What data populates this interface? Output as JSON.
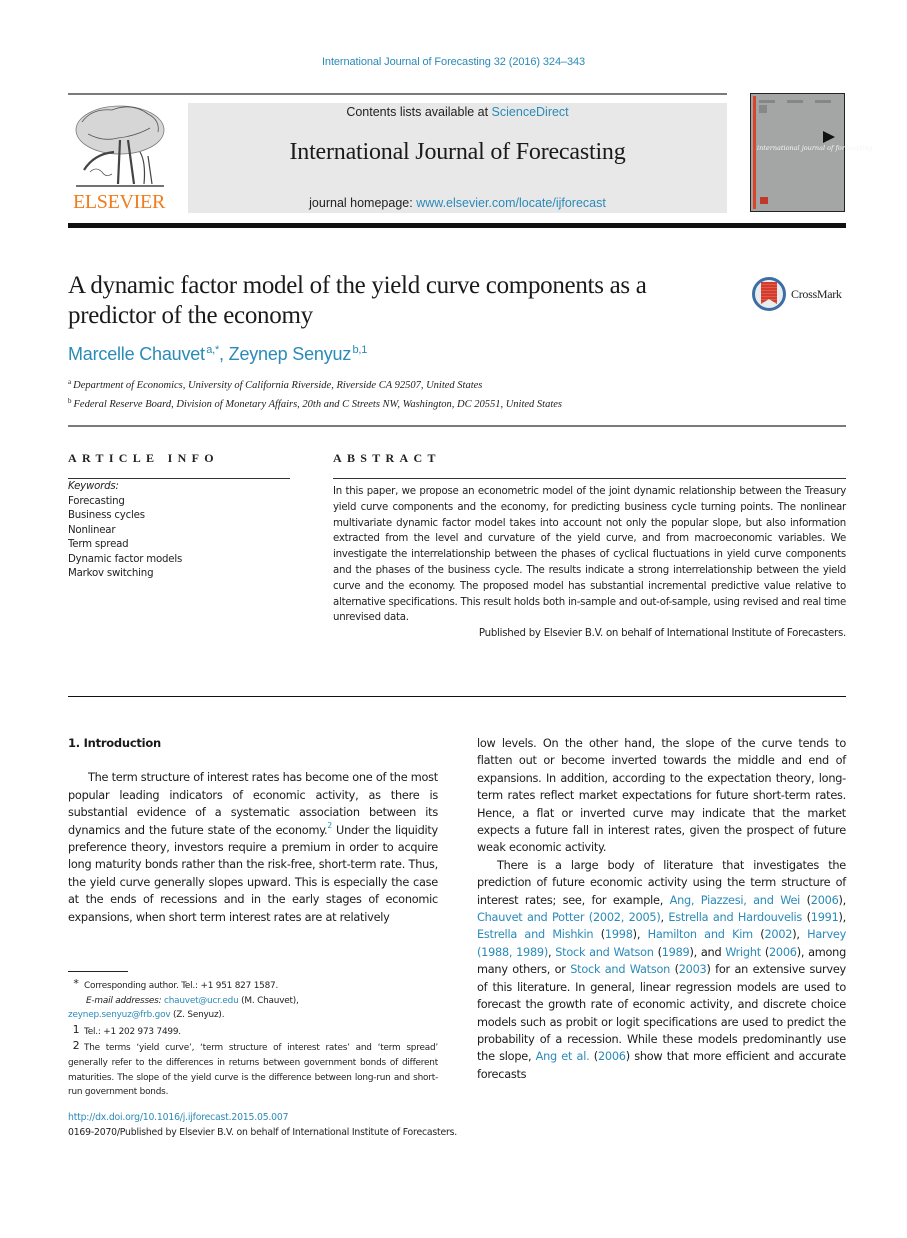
{
  "running_head": "International Journal of Forecasting 32 (2016) 324–343",
  "banner": {
    "contents_prefix": "Contents lists available at ",
    "contents_link": "ScienceDirect",
    "journal_title": "International Journal of Forecasting",
    "homepage_prefix": "journal homepage: ",
    "homepage_link": "www.elsevier.com/locate/ijforecast"
  },
  "publisher_logo": {
    "wordmark": "ELSEVIER",
    "icon": "elsevier-tree-icon",
    "color": "#f07c1c"
  },
  "cover": {
    "title": "international journal of forecasting",
    "icon": "journal-cover-thumbnail"
  },
  "article": {
    "title": "A dynamic factor model of the yield curve components as a predictor of the economy",
    "crossmark_label": "CrossMark",
    "authors": [
      {
        "name": "Marcelle Chauvet",
        "marks": "a,*"
      },
      {
        "name": "Zeynep Senyuz",
        "marks": "b,1"
      }
    ],
    "author_separator": ", ",
    "affiliations": [
      {
        "mark": "a",
        "text": "Department of Economics, University of California Riverside, Riverside CA 92507, United States"
      },
      {
        "mark": "b",
        "text": "Federal Reserve Board, Division of Monetary Affairs, 20th and C Streets NW, Washington, DC 20551, United States"
      }
    ]
  },
  "article_info": {
    "heading": "ARTICLE INFO",
    "keywords_label": "Keywords:",
    "keywords": [
      "Forecasting",
      "Business cycles",
      "Nonlinear",
      "Term spread",
      "Dynamic factor models",
      "Markov switching"
    ]
  },
  "abstract": {
    "heading": "ABSTRACT",
    "text": "In this paper, we propose an econometric model of the joint dynamic relationship between the Treasury yield curve components and the economy, for predicting business cycle turning points. The nonlinear multivariate dynamic factor model takes into account not only the popular slope, but also information extracted from the level and curvature of the yield curve, and from macroeconomic variables. We investigate the interrelationship between the phases of cyclical fluctuations in yield curve components and the phases of the business cycle. The results indicate a strong interrelationship between the yield curve and the economy. The proposed model has substantial incremental predictive value relative to alternative specifications. This result holds both in-sample and out-of-sample, using revised and real time unrevised data.",
    "publisher_note": "Published by Elsevier B.V. on behalf of International Institute of Forecasters."
  },
  "body": {
    "section_heading": "1.  Introduction",
    "left_para_1": "The term structure of interest rates has become one of the most popular leading indicators of economic activity, as there is substantial evidence of a systematic association between its dynamics and the future state of the economy.",
    "left_para_1_fnref": "2",
    "left_para_1_cont": " Under the liquidity preference theory, investors require a premium in order to acquire long maturity bonds rather than the risk-free, short-term rate. Thus, the yield curve generally slopes upward. This is especially the case at the ends of recessions and in the early stages of economic expansions, when short term interest rates are at relatively",
    "right_para_1": "low levels. On the other hand, the slope of the curve tends to flatten out or become inverted towards the middle and end of expansions. In addition, according to the expectation theory, long-term rates reflect market expectations for future short-term rates. Hence, a flat or inverted curve may indicate that the market expects a future fall in interest rates, given the prospect of future weak economic activity.",
    "right_para_2": {
      "t1": "There is a large body of literature that investigates the prediction of future economic activity using the term structure of interest rates; see, for example, ",
      "c1": "Ang, Piazzesi, and Wei",
      "t2": " (",
      "c1y": "2006",
      "t3": "), ",
      "c2": "Chauvet and Potter (2002, 2005)",
      "t4": ", ",
      "c3": "Estrella and Hardouvelis",
      "t5": " (",
      "c3y": "1991",
      "t6": "), ",
      "c4": "Estrella and Mishkin",
      "t7": " (",
      "c4y": "1998",
      "t8": "), ",
      "c5": "Hamilton and Kim",
      "t9": " (",
      "c5y": "2002",
      "t10": "), ",
      "c6": "Harvey (1988, 1989)",
      "t11": ", ",
      "c7": "Stock and Watson",
      "t12": " (",
      "c7y": "1989",
      "t13": "), and ",
      "c8": "Wright",
      "t14": " (",
      "c8y": "2006",
      "t15": "), among many others, or ",
      "c9": "Stock and Watson",
      "t16": " (",
      "c9y": "2003",
      "t17": ") for an extensive survey of this literature. In general, linear regression models are used to forecast the growth rate of economic activity, and discrete choice models such as probit or logit specifications are used to predict the probability of a recession. While these models predominantly use the slope, ",
      "c10": "Ang et al.",
      "t18": " (",
      "c10y": "2006",
      "t19": ") show that more efficient and accurate forecasts"
    }
  },
  "footnotes": {
    "star_mark": "*",
    "star_text": "Corresponding author. Tel.: +1 951 827 1587.",
    "email_label": "E-mail addresses:",
    "email_1": "chauvet@ucr.edu",
    "email_1_owner": " (M. Chauvet),",
    "email_2": "zeynep.senyuz@frb.gov",
    "email_2_owner": " (Z. Senyuz).",
    "fn1_mark": "1",
    "fn1_text": "Tel.: +1 202 973 7499.",
    "fn2_mark": "2",
    "fn2_text": "The terms ‘yield curve’, ‘term structure of interest rates’ and ‘term spread’ generally refer to the differences in returns between government bonds of different maturities. The slope of the yield curve is the difference between long-run and short-run government bonds."
  },
  "doi": {
    "link": "http://dx.doi.org/10.1016/j.ijforecast.2015.05.007",
    "copyright": "0169-2070/Published by Elsevier B.V. on behalf of International Institute of Forecasters."
  },
  "colors": {
    "link": "#2a8ab8",
    "elsevier_orange": "#f07c1c",
    "banner_bg": "#e8e8e8"
  }
}
